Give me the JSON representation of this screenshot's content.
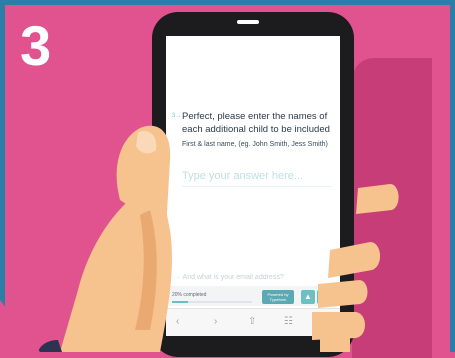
{
  "step": {
    "number": "3"
  },
  "form": {
    "question_number": "3→",
    "question": "Perfect, please enter the names of each additional child to be included",
    "hint": "First & last name, (eg. John Smith, Jess Smith)",
    "answer_placeholder": "Type your answer here...",
    "next_question": "→ And what is your email address?"
  },
  "footer": {
    "progress_label": "20% completed",
    "progress_fraction": 0.2,
    "powered_line1": "Powered by",
    "powered_line2": "Typeform"
  },
  "icons": {
    "next": "chevron-up-icon",
    "prev": "chevron-down-icon",
    "back": "back-arrow-icon",
    "forward": "forward-arrow-icon",
    "share": "share-icon",
    "bookmarks": "book-icon"
  },
  "colors": {
    "background": "#e0538f",
    "accent": "#6cbfc3",
    "border": "#2a7fa6"
  }
}
